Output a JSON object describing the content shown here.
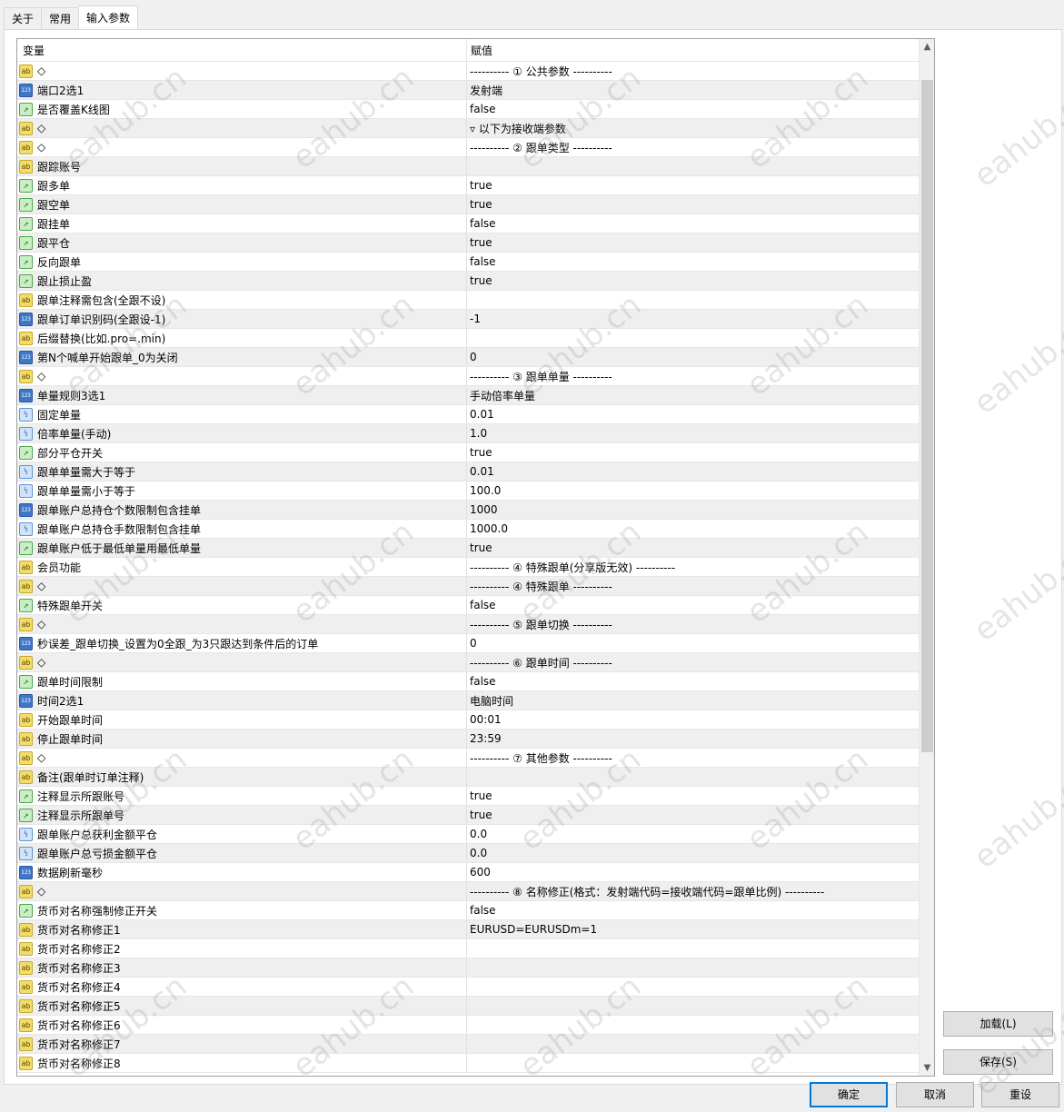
{
  "tabs": [
    "关于",
    "常用",
    "输入参数"
  ],
  "columns": {
    "variable": "变量",
    "value": "赋值"
  },
  "rows": [
    {
      "icon": "ab",
      "name": "◇",
      "value": "---------- ① 公共参数 ----------"
    },
    {
      "icon": "num",
      "name": "端口2选1",
      "value": "发射端"
    },
    {
      "icon": "bool",
      "name": "是否覆盖K线图",
      "value": "false"
    },
    {
      "icon": "ab",
      "name": "◇",
      "value": "▿ 以下为接收端参数"
    },
    {
      "icon": "ab",
      "name": "◇",
      "value": "---------- ② 跟单类型 ----------"
    },
    {
      "icon": "ab",
      "name": "跟踪账号",
      "value": ""
    },
    {
      "icon": "bool",
      "name": "跟多单",
      "value": "true"
    },
    {
      "icon": "bool",
      "name": "跟空单",
      "value": "true"
    },
    {
      "icon": "bool",
      "name": "跟挂单",
      "value": "false"
    },
    {
      "icon": "bool",
      "name": "跟平仓",
      "value": "true"
    },
    {
      "icon": "bool",
      "name": "反向跟单",
      "value": "false"
    },
    {
      "icon": "bool",
      "name": "跟止损止盈",
      "value": "true"
    },
    {
      "icon": "ab",
      "name": "跟单注释需包含(全跟不设)",
      "value": ""
    },
    {
      "icon": "num",
      "name": "跟单订单识别码(全跟设-1)",
      "value": "-1"
    },
    {
      "icon": "ab",
      "name": "后缀替换(比如.pro=.min)",
      "value": ""
    },
    {
      "icon": "num",
      "name": "第N个喊单开始跟单_0为关闭",
      "value": "0"
    },
    {
      "icon": "ab",
      "name": "◇",
      "value": "---------- ③ 跟单单量 ----------"
    },
    {
      "icon": "num",
      "name": "单量规则3选1",
      "value": "手动倍率单量"
    },
    {
      "icon": "dbl",
      "name": "固定单量",
      "value": "0.01"
    },
    {
      "icon": "dbl",
      "name": "倍率单量(手动)",
      "value": "1.0"
    },
    {
      "icon": "bool",
      "name": "部分平仓开关",
      "value": "true"
    },
    {
      "icon": "dbl",
      "name": "跟单单量需大于等于",
      "value": "0.01"
    },
    {
      "icon": "dbl",
      "name": "跟单单量需小于等于",
      "value": "100.0"
    },
    {
      "icon": "num",
      "name": "跟单账户总持仓个数限制包含挂单",
      "value": "1000"
    },
    {
      "icon": "dbl",
      "name": "跟单账户总持仓手数限制包含挂单",
      "value": "1000.0"
    },
    {
      "icon": "bool",
      "name": "跟单账户低于最低单量用最低单量",
      "value": "true"
    },
    {
      "icon": "ab",
      "name": "会员功能",
      "value": "---------- ④ 特殊跟单(分享版无效) ----------"
    },
    {
      "icon": "ab",
      "name": "◇",
      "value": "---------- ④ 特殊跟单 ----------"
    },
    {
      "icon": "bool",
      "name": "特殊跟单开关",
      "value": "false"
    },
    {
      "icon": "ab",
      "name": "◇",
      "value": "---------- ⑤ 跟单切换 ----------"
    },
    {
      "icon": "num",
      "name": "秒误差_跟单切换_设置为0全跟_为3只跟达到条件后的订单",
      "value": "0"
    },
    {
      "icon": "ab",
      "name": "◇",
      "value": "---------- ⑥ 跟单时间 ----------"
    },
    {
      "icon": "bool",
      "name": "跟单时间限制",
      "value": "false"
    },
    {
      "icon": "num",
      "name": "时间2选1",
      "value": "电脑时间"
    },
    {
      "icon": "ab",
      "name": "开始跟单时间",
      "value": "00:01"
    },
    {
      "icon": "ab",
      "name": "停止跟单时间",
      "value": "23:59"
    },
    {
      "icon": "ab",
      "name": "◇",
      "value": "---------- ⑦ 其他参数 ----------"
    },
    {
      "icon": "ab",
      "name": "备注(跟单时订单注释)",
      "value": ""
    },
    {
      "icon": "bool",
      "name": "注释显示所跟账号",
      "value": "true"
    },
    {
      "icon": "bool",
      "name": "注释显示所跟单号",
      "value": "true"
    },
    {
      "icon": "dbl",
      "name": "跟单账户总获利金额平仓",
      "value": "0.0"
    },
    {
      "icon": "dbl",
      "name": "跟单账户总亏损金额平仓",
      "value": "0.0"
    },
    {
      "icon": "num",
      "name": "数据刷新毫秒",
      "value": "600"
    },
    {
      "icon": "ab",
      "name": "◇",
      "value": "---------- ⑧ 名称修正(格式：发射端代码=接收端代码=跟单比例) ----------"
    },
    {
      "icon": "bool",
      "name": "货币对名称强制修正开关",
      "value": "false"
    },
    {
      "icon": "ab",
      "name": "货币对名称修正1",
      "value": "EURUSD=EURUSDm=1"
    },
    {
      "icon": "ab",
      "name": "货币对名称修正2",
      "value": ""
    },
    {
      "icon": "ab",
      "name": "货币对名称修正3",
      "value": ""
    },
    {
      "icon": "ab",
      "name": "货币对名称修正4",
      "value": ""
    },
    {
      "icon": "ab",
      "name": "货币对名称修正5",
      "value": ""
    },
    {
      "icon": "ab",
      "name": "货币对名称修正6",
      "value": ""
    },
    {
      "icon": "ab",
      "name": "货币对名称修正7",
      "value": ""
    },
    {
      "icon": "ab",
      "name": "货币对名称修正8",
      "value": ""
    }
  ],
  "icon_glyphs": {
    "ab": "ab",
    "num": "123",
    "bool": "↗",
    "dbl": "½"
  },
  "side_buttons": {
    "load": "加载(L)",
    "save": "保存(S)"
  },
  "footer_buttons": {
    "ok": "确定",
    "cancel": "取消",
    "reset": "重设"
  },
  "watermark": "eahub.cn"
}
